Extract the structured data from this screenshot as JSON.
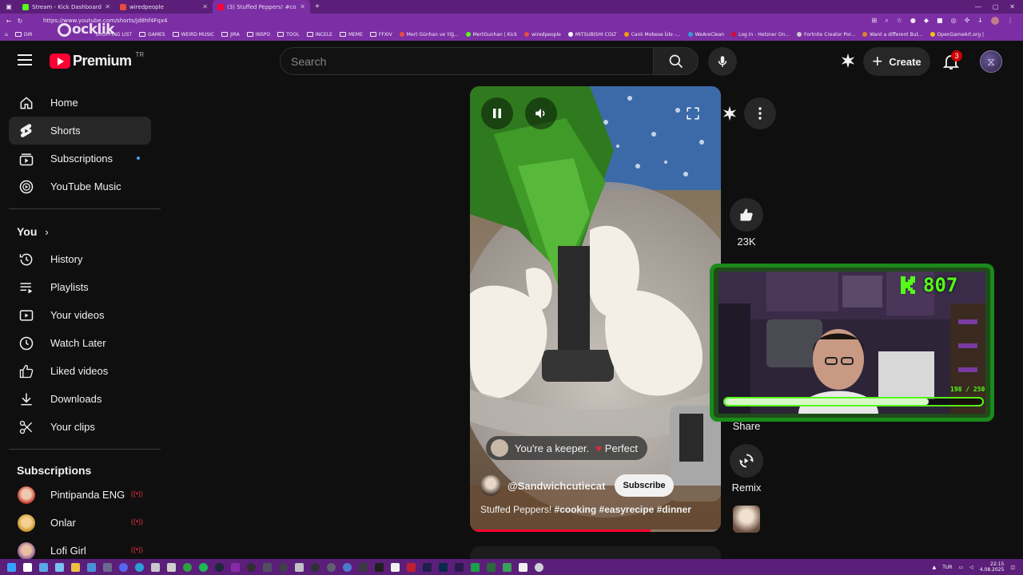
{
  "browser": {
    "tabs": [
      {
        "title": "Stream - Kick Dashboard",
        "favicon_color": "#53fc18"
      },
      {
        "title": "wiredpeople",
        "favicon_color": "#e74c3c"
      },
      {
        "title": "(3) Stuffed Peppers! #cookin...",
        "favicon_color": "#ff0033"
      }
    ],
    "url": "https://www.youtube.com/shorts/jd8hf4Fqx4",
    "bookmarks": [
      {
        "label": "DIR",
        "kind": "folder"
      },
      {
        "label": "SHOPPING LIST",
        "kind": "folder"
      },
      {
        "label": "GAMES",
        "kind": "folder"
      },
      {
        "label": "WEIRD MUSIC",
        "kind": "folder"
      },
      {
        "label": "JIRA",
        "kind": "folder"
      },
      {
        "label": "INSPO",
        "kind": "folder"
      },
      {
        "label": "TOOL",
        "kind": "folder"
      },
      {
        "label": "INCELE",
        "kind": "folder"
      },
      {
        "label": "MEME",
        "kind": "folder"
      },
      {
        "label": "FFXIV",
        "kind": "folder"
      },
      {
        "label": "Mert Günhan ve Yiğ...",
        "kind": "link",
        "color": "#e74c3c"
      },
      {
        "label": "MertGunhan | Kick",
        "kind": "link",
        "color": "#53fc18"
      },
      {
        "label": "wiredpeople",
        "kind": "link",
        "color": "#e74c3c"
      },
      {
        "label": "MITSUBISHI COLT",
        "kind": "link",
        "color": "#ffffff"
      },
      {
        "label": "Canlı Mobese İzle -...",
        "kind": "link",
        "color": "#f39c12"
      },
      {
        "label": "WeAreClean",
        "kind": "link",
        "color": "#3498db"
      },
      {
        "label": "Log In - Hetzner On...",
        "kind": "link",
        "color": "#d50c2d"
      },
      {
        "label": "Fortnite Creator Por...",
        "kind": "link",
        "color": "#cccccc"
      },
      {
        "label": "Want a different But...",
        "kind": "link",
        "color": "#e67e22"
      },
      {
        "label": "OpenGameArt.org |",
        "kind": "link",
        "color": "#f1c40f"
      }
    ]
  },
  "watermark": {
    "text": "ocklik"
  },
  "header": {
    "logo_text": "Premium",
    "country_code": "TR",
    "search_placeholder": "Search",
    "create_label": "Create",
    "notification_count": "3"
  },
  "sidebar": {
    "main": [
      {
        "label": "Home",
        "icon": "home-icon"
      },
      {
        "label": "Shorts",
        "icon": "shorts-icon",
        "active": true
      },
      {
        "label": "Subscriptions",
        "icon": "subscriptions-icon",
        "new_dot": true
      },
      {
        "label": "YouTube Music",
        "icon": "youtube-music-icon"
      }
    ],
    "you_heading": "You",
    "you": [
      {
        "label": "History",
        "icon": "history-icon"
      },
      {
        "label": "Playlists",
        "icon": "playlists-icon"
      },
      {
        "label": "Your videos",
        "icon": "your-videos-icon"
      },
      {
        "label": "Watch Later",
        "icon": "clock-icon"
      },
      {
        "label": "Liked videos",
        "icon": "thumbs-up-icon"
      },
      {
        "label": "Downloads",
        "icon": "download-icon"
      },
      {
        "label": "Your clips",
        "icon": "scissors-icon"
      }
    ],
    "subscriptions_heading": "Subscriptions",
    "subscriptions": [
      {
        "label": "Pintipanda ENG",
        "live": true,
        "color": "#c0392b"
      },
      {
        "label": "Onlar",
        "live": true,
        "color": "#c8912a"
      },
      {
        "label": "Lofi Girl",
        "live": true,
        "color": "#8e5a9a"
      }
    ]
  },
  "short": {
    "comment_highlight": "You're a keeper.",
    "comment_suffix": "Perfect",
    "channel": "@Sandwichcutiecat",
    "subscribe_label": "Subscribe",
    "caption_plain": "Stuffed Peppers!",
    "caption_tags": "#cooking #easyrecipe #dinner",
    "progress": 0.72
  },
  "actions": {
    "likes": "23K",
    "share_label": "Share",
    "remix_label": "Remix"
  },
  "stream_overlay": {
    "viewer_count": "807",
    "goal_text": "198 / 250",
    "goal_current": 198,
    "goal_target": 250,
    "accent": "#53fc18"
  },
  "taskbar": {
    "language": "TUR",
    "time": "22:15",
    "date": "4.08.2025"
  }
}
